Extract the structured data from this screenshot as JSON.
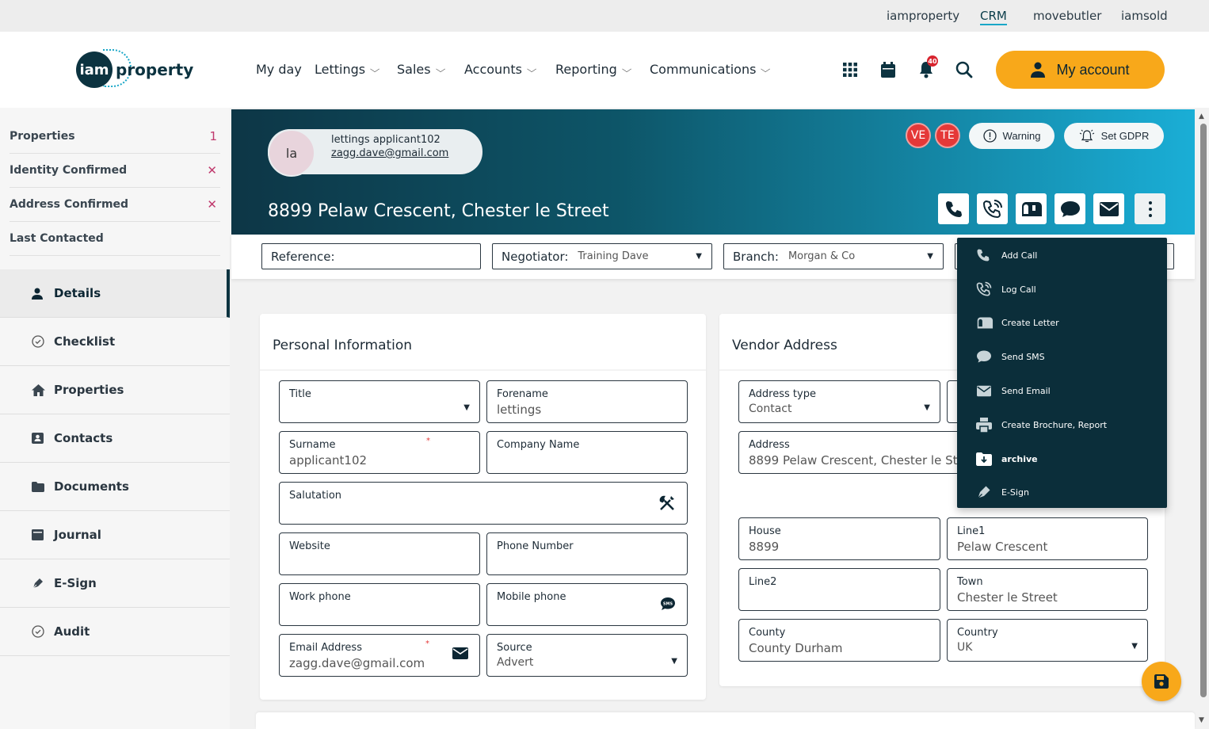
{
  "topbar": {
    "links": [
      "iamproperty",
      "CRM",
      "movebutler",
      "iamsold"
    ],
    "active": "CRM"
  },
  "logo": {
    "mark": "iam",
    "text": "property"
  },
  "nav": {
    "items": [
      "My day",
      "Lettings",
      "Sales",
      "Accounts",
      "Reporting",
      "Communications"
    ]
  },
  "header_icons": {
    "notifications_count": "40",
    "account_label": "My account"
  },
  "sidebar": {
    "summary": [
      {
        "label": "Properties",
        "value": "1"
      },
      {
        "label": "Identity Confirmed",
        "value": "✕"
      },
      {
        "label": "Address Confirmed",
        "value": "✕"
      },
      {
        "label": "Last Contacted",
        "value": ""
      }
    ],
    "menu": [
      "Details",
      "Checklist",
      "Properties",
      "Contacts",
      "Documents",
      "Journal",
      "E-Sign",
      "Audit"
    ],
    "active": "Details"
  },
  "banner": {
    "avatar_initials": "la",
    "name": "lettings applicant102",
    "email": "zagg.dave@gmail.com",
    "address_title": "8899 Pelaw Crescent, Chester le Street",
    "badges": [
      "VE",
      "TE"
    ],
    "warning_label": "Warning",
    "gdpr_label": "Set GDPR"
  },
  "filters": {
    "reference_label": "Reference:",
    "reference_value": "",
    "negotiator_label": "Negotiator:",
    "negotiator_value": "Training Dave",
    "branch_label": "Branch:",
    "branch_value": "Morgan & Co"
  },
  "personal": {
    "title": "Personal Information",
    "fields": {
      "title_label": "Title",
      "title_value": "",
      "forename_label": "Forename",
      "forename_value": "lettings",
      "surname_label": "Surname",
      "surname_value": "applicant102",
      "company_label": "Company Name",
      "company_value": "",
      "salutation_label": "Salutation",
      "salutation_value": "",
      "website_label": "Website",
      "website_value": "",
      "phone_label": "Phone Number",
      "phone_value": "",
      "work_label": "Work phone",
      "work_value": "",
      "mobile_label": "Mobile phone",
      "mobile_value": "",
      "email_label": "Email Address",
      "email_value": "zagg.dave@gmail.com",
      "source_label": "Source",
      "source_value": "Advert"
    },
    "required_mark": "*"
  },
  "vendor": {
    "title": "Vendor Address",
    "fields": {
      "type_label": "Address type",
      "type_value": "Contact",
      "address_label": "Address",
      "address_value": "8899 Pelaw Crescent, Chester le Stre",
      "house_label": "House",
      "house_value": "8899",
      "line1_label": "Line1",
      "line1_value": "Pelaw Crescent",
      "line2_label": "Line2",
      "line2_value": "",
      "town_label": "Town",
      "town_value": "Chester le Street",
      "county_label": "County",
      "county_value": "County Durham",
      "country_label": "Country",
      "country_value": "UK"
    }
  },
  "dropdown": {
    "items": [
      "Add Call",
      "Log Call",
      "Create Letter",
      "Send SMS",
      "Send Email",
      "Create Brochure, Report",
      "archive",
      "E-Sign"
    ]
  },
  "colors": {
    "brand_dark": "#0c3340",
    "accent": "#f8a81a",
    "banner_end": "#1aaed6",
    "badge_red": "#e53838"
  }
}
